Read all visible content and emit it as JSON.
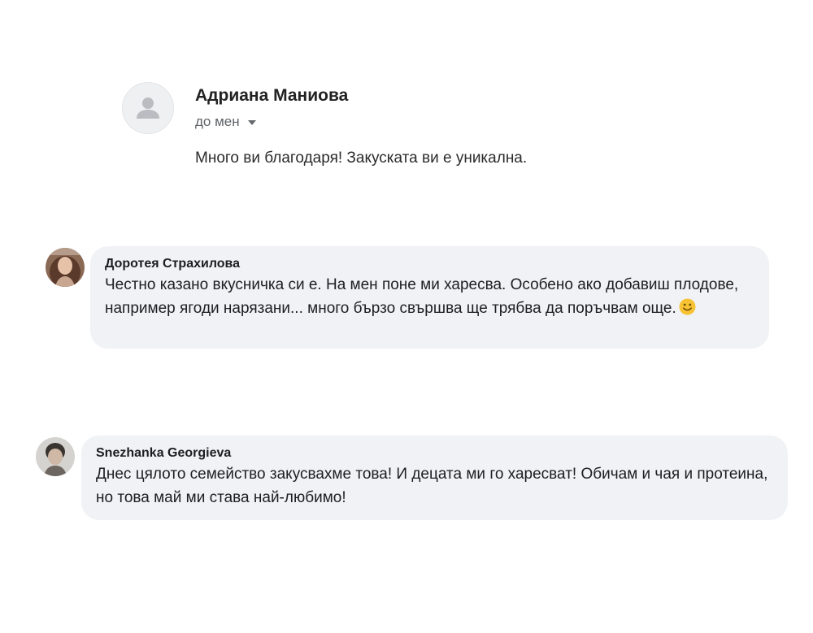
{
  "email": {
    "sender": "Адриана Маниова",
    "recipient": "до мен",
    "body": "Много ви благодаря! Закуската ви е уникална.",
    "avatar_icon": "person-placeholder-icon",
    "recipient_icon": "caret-down-icon"
  },
  "comments": [
    {
      "author": "Доротея Страхилова",
      "text": "Честно казано вкусничка си е. На мен поне ми харесва. Особено ако добавиш плодове, например ягоди нарязани... много бързо свършва ще трябва да поръчвам още.",
      "emoji_icon": "smiley-face-icon"
    },
    {
      "author": "Snezhanka Georgieva",
      "text": "Днес цялото семейство закусвахме това! И децата ми го харесват! Обичам и чая и протеина, но това май ми става най-любимо!"
    }
  ],
  "colors": {
    "bubble": "#f0f2f5",
    "muted_text": "#5f6368",
    "emoji": "#f7c234"
  }
}
